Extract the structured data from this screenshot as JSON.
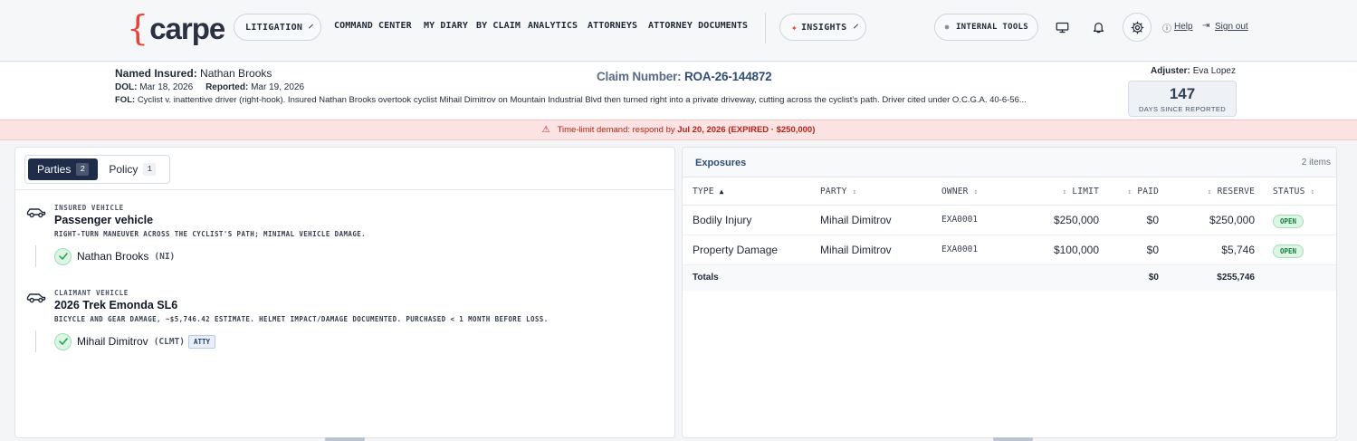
{
  "brand": {
    "logo_brace": "{",
    "logo_text": "carpe",
    "accent": "#e8413a"
  },
  "nav": {
    "litigation": "LITIGATION",
    "links": [
      "COMMAND CENTER",
      "MY DIARY",
      "BY CLAIM",
      "ANALYTICS",
      "ATTORNEYS",
      "ATTORNEY DOCUMENTS"
    ],
    "insights": "INSIGHTS",
    "internal_tools": "INTERNAL TOOLS",
    "help": "Help",
    "signout": "Sign out"
  },
  "claim": {
    "named_insured_label": "Named Insured:",
    "named_insured": "Nathan Brooks",
    "dol_label": "DOL:",
    "dol": "Mar 18, 2026",
    "reported_label": "Reported:",
    "reported": "Mar 19, 2026",
    "fol_label": "FOL:",
    "fol": "Cyclist v. inattentive driver (right-hook). Insured Nathan Brooks overtook cyclist Mihail Dimitrov on Mountain Industrial Blvd then turned right into a private driveway, cutting across the cyclist's path. Driver cited under O.C.G.A. 40-6-56...",
    "claim_number_label": "Claim Number:",
    "claim_number": "ROA-26-144872",
    "adjuster_label": "Adjuster:",
    "adjuster": "Eva Lopez",
    "days_since_reported": "147",
    "days_label": "DAYS SINCE REPORTED"
  },
  "alert": {
    "icon": "warning-icon",
    "prefix": "Time-limit demand: respond by",
    "date": "Jul 20, 2026",
    "suffix": "(EXPIRED · $250,000)"
  },
  "tabs": [
    {
      "label": "Parties",
      "count": "2"
    },
    {
      "label": "Policy",
      "count": "1"
    }
  ],
  "vehicles": [
    {
      "category": "INSURED VEHICLE",
      "name": "Passenger vehicle",
      "description": "RIGHT-TURN MANEUVER ACROSS THE CYCLIST'S PATH; MINIMAL VEHICLE DAMAGE.",
      "party": {
        "name": "Nathan Brooks",
        "role": "(NI)",
        "badge": ""
      }
    },
    {
      "category": "CLAIMANT VEHICLE",
      "name": "2026 Trek Emonda SL6",
      "description": "BICYCLE AND GEAR DAMAGE, ~$5,746.42 ESTIMATE. HELMET IMPACT/DAMAGE DOCUMENTED. PURCHASED < 1 MONTH BEFORE LOSS.",
      "party": {
        "name": "Mihail Dimitrov",
        "role": "(CLMT)",
        "badge": "ATTY"
      }
    }
  ],
  "exposures": {
    "title": "Exposures",
    "count_text": "2 items",
    "columns": {
      "type": "TYPE",
      "party": "PARTY",
      "owner": "OWNER",
      "limit": "LIMIT",
      "paid": "PAID",
      "reserve": "RESERVE",
      "status": "STATUS"
    },
    "rows": [
      {
        "type": "Bodily Injury",
        "party": "Mihail Dimitrov",
        "owner": "EXA0001",
        "limit": "$250,000",
        "paid": "$0",
        "reserve": "$250,000",
        "status": "OPEN"
      },
      {
        "type": "Property Damage",
        "party": "Mihail Dimitrov",
        "owner": "EXA0001",
        "limit": "$100,000",
        "paid": "$0",
        "reserve": "$5,746",
        "status": "OPEN"
      }
    ],
    "totals": {
      "label": "Totals",
      "paid": "$0",
      "reserve": "$255,746"
    }
  }
}
